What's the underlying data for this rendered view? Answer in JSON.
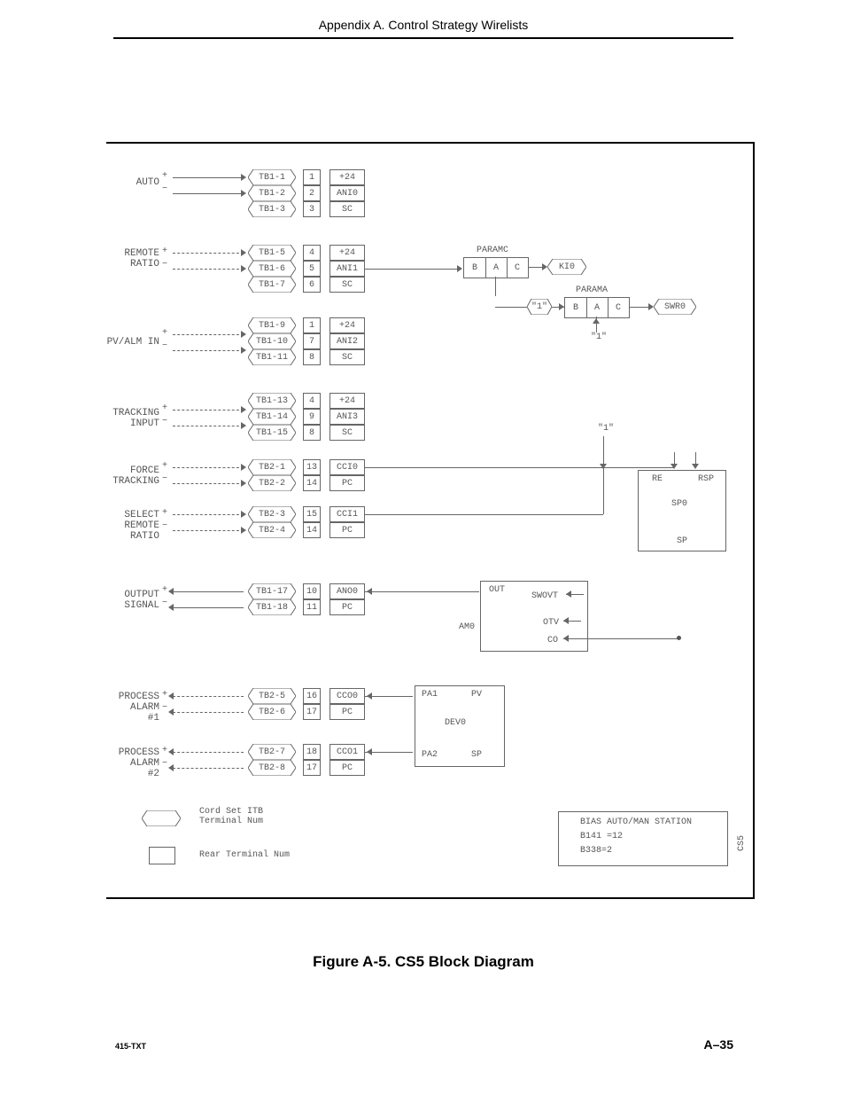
{
  "header": {
    "title": "Appendix A. Control Strategy Wirelists"
  },
  "caption": "Figure A-5.  CS5 Block Diagram",
  "footer": {
    "left": "415-TXT",
    "right": "A–35"
  },
  "signals": {
    "auto": "AUTO",
    "remote_ratio": "REMOTE\nRATIO",
    "pv_alm_in": "PV/ALM IN",
    "tracking_input": "TRACKING\nINPUT",
    "force_tracking": "FORCE\nTRACKING",
    "select_remote_ratio": "SELECT\nREMOTE\nRATIO",
    "output_signal": "OUTPUT\nSIGNAL",
    "process_alarm_1": "PROCESS\nALARM\n#1",
    "process_alarm_2": "PROCESS\nALARM\n#2"
  },
  "hex": {
    "TB1_1": "TB1-1",
    "TB1_2": "TB1-2",
    "TB1_3": "TB1-3",
    "TB1_5": "TB1-5",
    "TB1_6": "TB1-6",
    "TB1_7": "TB1-7",
    "TB1_9": "TB1-9",
    "TB1_10": "TB1-10",
    "TB1_11": "TB1-11",
    "TB1_13": "TB1-13",
    "TB1_14": "TB1-14",
    "TB1_15": "TB1-15",
    "TB2_1": "TB2-1",
    "TB2_2": "TB2-2",
    "TB2_3": "TB2-3",
    "TB2_4": "TB2-4",
    "TB1_17": "TB1-17",
    "TB1_18": "TB1-18",
    "TB2_5": "TB2-5",
    "TB2_6": "TB2-6",
    "TB2_7": "TB2-7",
    "TB2_8": "TB2-8",
    "KI0": "KI0",
    "SWR0": "SWR0"
  },
  "num": {
    "n1": "1",
    "n2": "2",
    "n3": "3",
    "n4": "4",
    "n5": "5",
    "n6": "6",
    "n7": "7",
    "n8": "8",
    "n9": "9",
    "n10": "10",
    "n11": "11",
    "n13": "13",
    "n14a": "14",
    "n15": "15",
    "n14b": "14",
    "n10b": "10",
    "n11b": "11",
    "n16": "16",
    "n17a": "17",
    "n18": "18",
    "n17b": "17"
  },
  "type": {
    "p24": "+24",
    "ANI0": "ANI0",
    "SC": "SC",
    "ANI1": "ANI1",
    "ANI2": "ANI2",
    "ANI3": "ANI3",
    "CCI0": "CCI0",
    "PC": "PC",
    "CCI1": "CCI1",
    "ANO0": "ANO0",
    "CCO0": "CCO0",
    "CCO1": "CCO1"
  },
  "blocks": {
    "paramc": "PARAMC",
    "parama": "PARAMA",
    "bac_b": "B",
    "bac_a": "A",
    "bac_c": "C",
    "one": "\"1\"",
    "sp0_re": "RE",
    "sp0_rsp": "RSP",
    "sp0_title": "SP0",
    "sp0_sp": "SP",
    "am0_title": "AM0",
    "am0_out": "OUT",
    "am0_swovt": "SWOVT",
    "am0_otv": "OTV",
    "am0_co": "CO",
    "dev0_title": "DEV0",
    "dev0_pa1": "PA1",
    "dev0_pv": "PV",
    "dev0_pa2": "PA2",
    "dev0_sp": "SP",
    "info_title": "BIAS AUTO/MAN STATION",
    "info_b141": "B141 =12",
    "info_b338": "B338=2",
    "cs5": "CS5"
  },
  "legend": {
    "hex_text": "Cord Set ITB\nTerminal Num",
    "rect_text": "Rear Terminal Num"
  }
}
